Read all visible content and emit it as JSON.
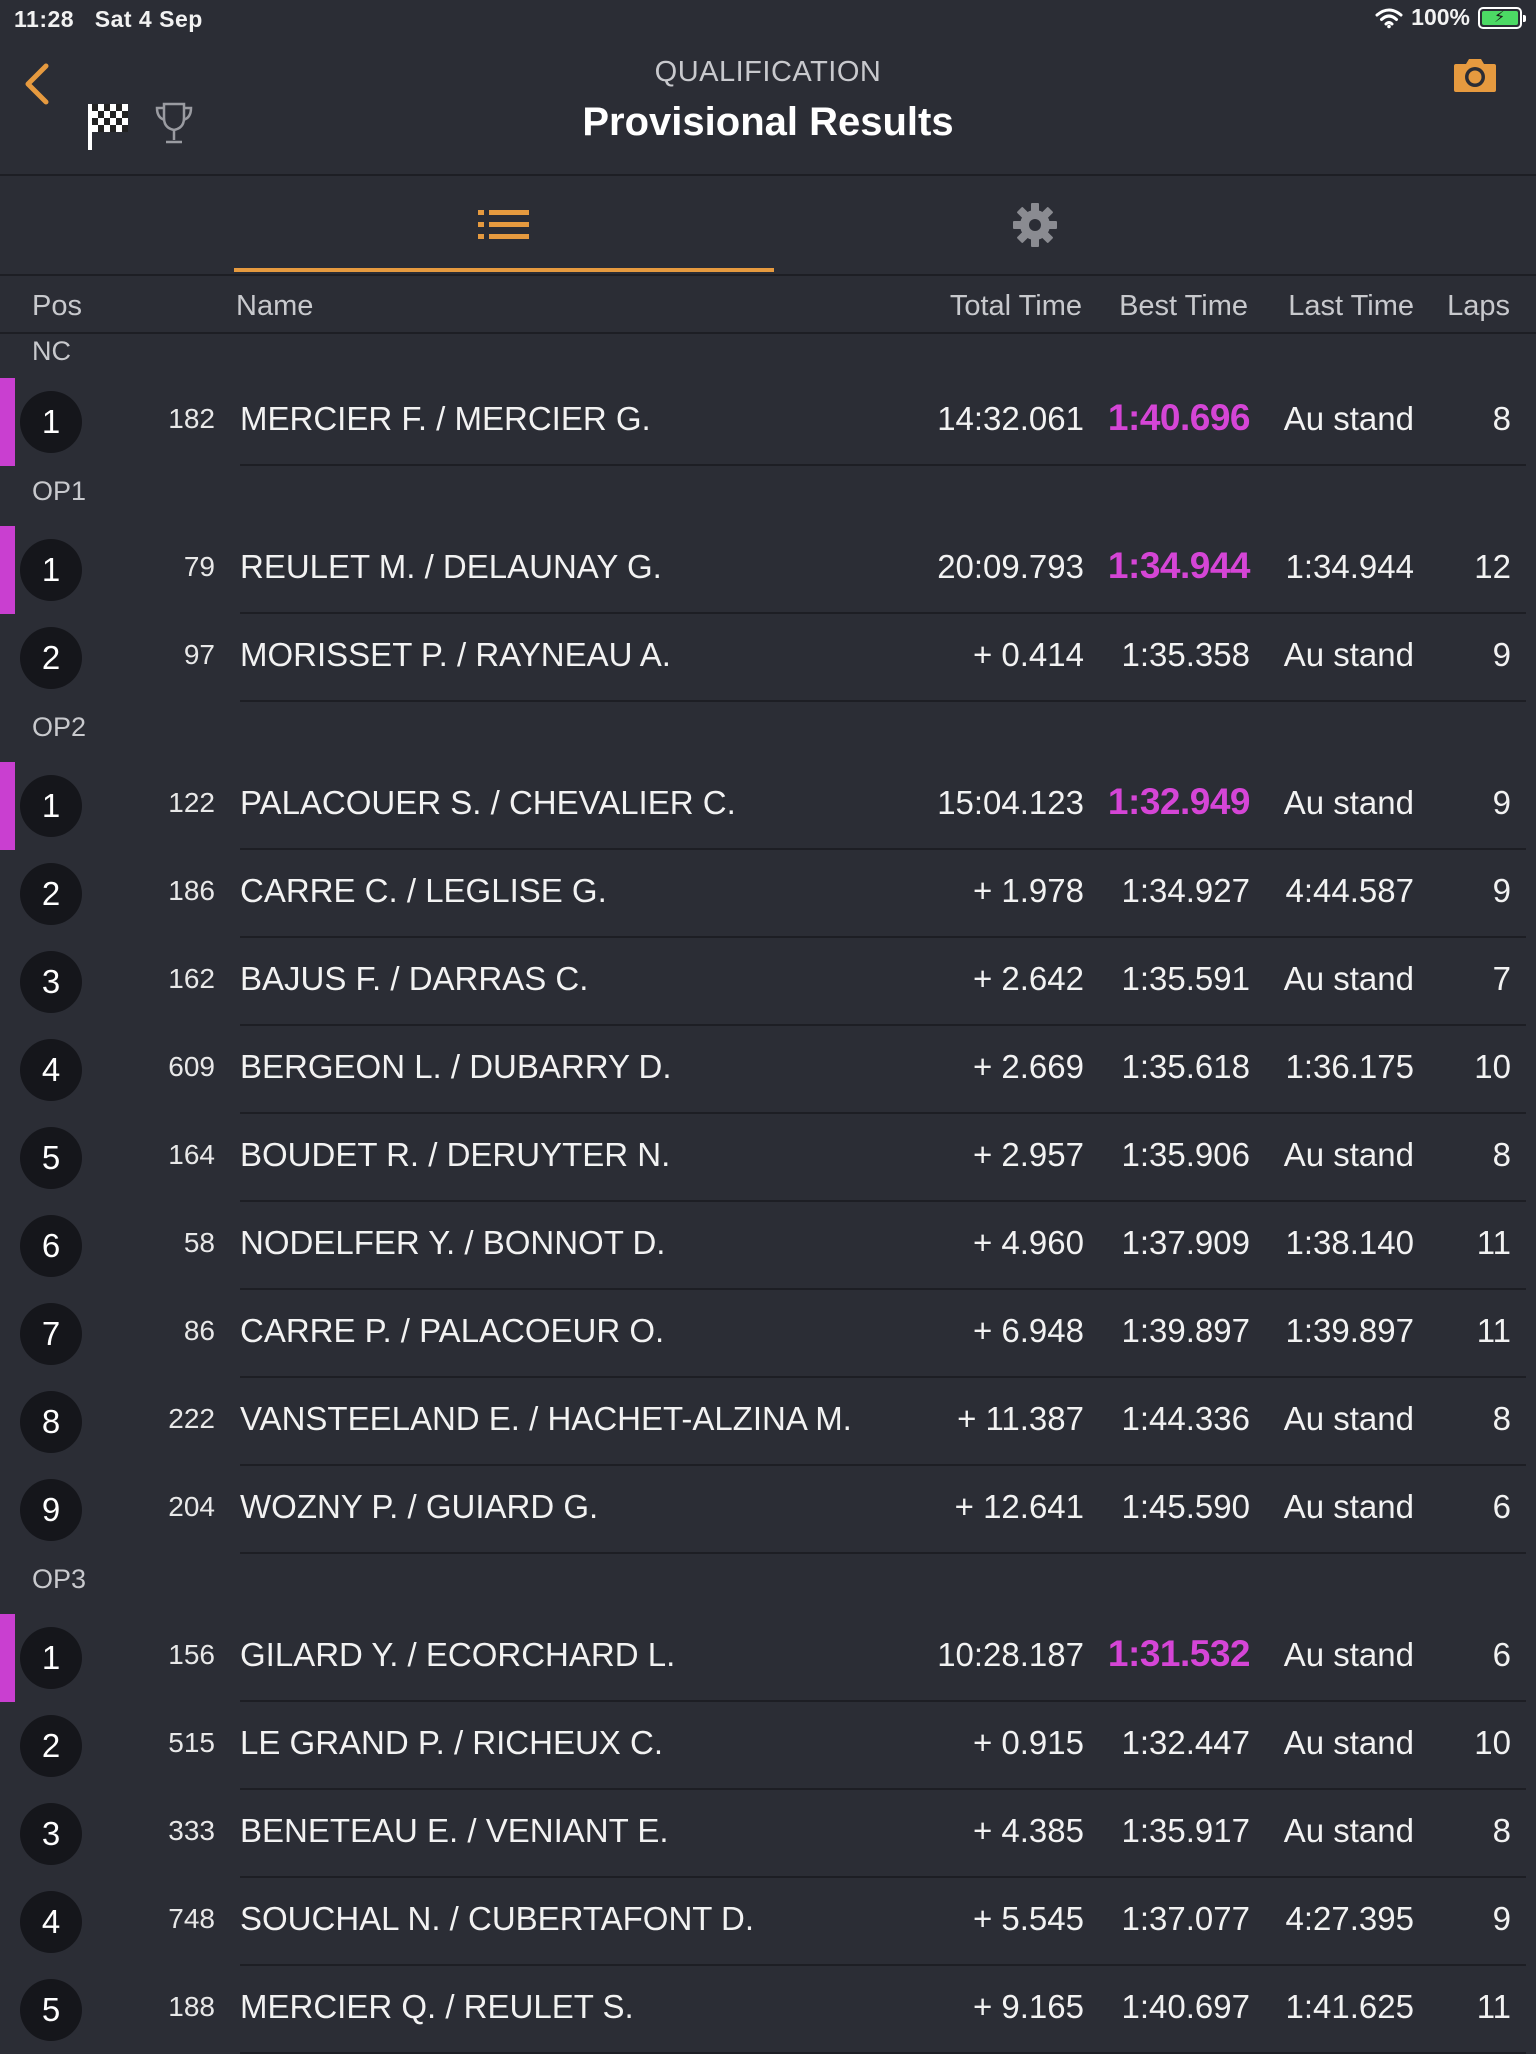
{
  "status_bar": {
    "time": "11:28",
    "date": "Sat 4 Sep",
    "battery": "100%"
  },
  "header": {
    "subtitle": "QUALIFICATION",
    "title": "Provisional Results"
  },
  "columns": {
    "pos": "Pos",
    "name": "Name",
    "total": "Total Time",
    "best": "Best Time",
    "last": "Last Time",
    "laps": "Laps"
  },
  "groups": [
    {
      "label": "NC",
      "rows": [
        {
          "pos": "1",
          "num": "182",
          "name": "MERCIER F. / MERCIER G.",
          "total": "14:32.061",
          "best": "1:40.696",
          "best_fast": true,
          "last": "Au stand",
          "laps": "8",
          "leader": true
        }
      ]
    },
    {
      "label": "OP1",
      "rows": [
        {
          "pos": "1",
          "num": "79",
          "name": "REULET M. / DELAUNAY G.",
          "total": "20:09.793",
          "best": "1:34.944",
          "best_fast": true,
          "last": "1:34.944",
          "laps": "12",
          "leader": true
        },
        {
          "pos": "2",
          "num": "97",
          "name": "MORISSET P. / RAYNEAU A.",
          "total": "+ 0.414",
          "best": "1:35.358",
          "best_fast": false,
          "last": "Au stand",
          "laps": "9",
          "leader": false
        }
      ]
    },
    {
      "label": "OP2",
      "rows": [
        {
          "pos": "1",
          "num": "122",
          "name": "PALACOUER S. / CHEVALIER C.",
          "total": "15:04.123",
          "best": "1:32.949",
          "best_fast": true,
          "last": "Au stand",
          "laps": "9",
          "leader": true
        },
        {
          "pos": "2",
          "num": "186",
          "name": "CARRE C. / LEGLISE G.",
          "total": "+ 1.978",
          "best": "1:34.927",
          "best_fast": false,
          "last": "4:44.587",
          "laps": "9",
          "leader": false
        },
        {
          "pos": "3",
          "num": "162",
          "name": "BAJUS F. / DARRAS C.",
          "total": "+ 2.642",
          "best": "1:35.591",
          "best_fast": false,
          "last": "Au stand",
          "laps": "7",
          "leader": false
        },
        {
          "pos": "4",
          "num": "609",
          "name": "BERGEON L. / DUBARRY D.",
          "total": "+ 2.669",
          "best": "1:35.618",
          "best_fast": false,
          "last": "1:36.175",
          "laps": "10",
          "leader": false
        },
        {
          "pos": "5",
          "num": "164",
          "name": "BOUDET R. / DERUYTER N.",
          "total": "+ 2.957",
          "best": "1:35.906",
          "best_fast": false,
          "last": "Au stand",
          "laps": "8",
          "leader": false
        },
        {
          "pos": "6",
          "num": "58",
          "name": "NODELFER Y. / BONNOT D.",
          "total": "+ 4.960",
          "best": "1:37.909",
          "best_fast": false,
          "last": "1:38.140",
          "laps": "11",
          "leader": false
        },
        {
          "pos": "7",
          "num": "86",
          "name": "CARRE P. / PALACOEUR O.",
          "total": "+ 6.948",
          "best": "1:39.897",
          "best_fast": false,
          "last": "1:39.897",
          "laps": "11",
          "leader": false
        },
        {
          "pos": "8",
          "num": "222",
          "name": "VANSTEELAND E. / HACHET-ALZINA M.",
          "total": "+ 11.387",
          "best": "1:44.336",
          "best_fast": false,
          "last": "Au stand",
          "laps": "8",
          "leader": false
        },
        {
          "pos": "9",
          "num": "204",
          "name": "WOZNY P. / GUIARD G.",
          "total": "+ 12.641",
          "best": "1:45.590",
          "best_fast": false,
          "last": "Au stand",
          "laps": "6",
          "leader": false
        }
      ]
    },
    {
      "label": "OP3",
      "rows": [
        {
          "pos": "1",
          "num": "156",
          "name": "GILARD Y. / ECORCHARD L.",
          "total": "10:28.187",
          "best": "1:31.532",
          "best_fast": true,
          "last": "Au stand",
          "laps": "6",
          "leader": true
        },
        {
          "pos": "2",
          "num": "515",
          "name": "LE GRAND P. / RICHEUX C.",
          "total": "+ 0.915",
          "best": "1:32.447",
          "best_fast": false,
          "last": "Au stand",
          "laps": "10",
          "leader": false
        },
        {
          "pos": "3",
          "num": "333",
          "name": "BENETEAU E. / VENIANT E.",
          "total": "+ 4.385",
          "best": "1:35.917",
          "best_fast": false,
          "last": "Au stand",
          "laps": "8",
          "leader": false
        },
        {
          "pos": "4",
          "num": "748",
          "name": "SOUCHAL N. / CUBERTAFONT D.",
          "total": "+ 5.545",
          "best": "1:37.077",
          "best_fast": false,
          "last": "4:27.395",
          "laps": "9",
          "leader": false
        },
        {
          "pos": "5",
          "num": "188",
          "name": "MERCIER Q. / REULET S.",
          "total": "+ 9.165",
          "best": "1:40.697",
          "best_fast": false,
          "last": "1:41.625",
          "laps": "11",
          "leader": false
        }
      ]
    }
  ],
  "colors": {
    "accent": "#e69a3f",
    "fastest": "#d545d6",
    "background": "#2b2d35"
  }
}
